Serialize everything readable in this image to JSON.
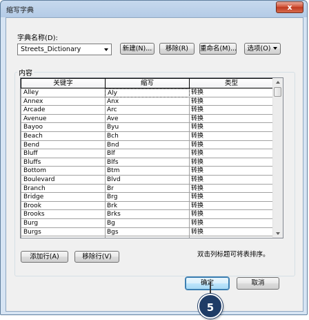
{
  "window": {
    "title": "缩写字典",
    "close_glyph": "x"
  },
  "dictionary": {
    "label": "字典名称(D):",
    "selected": "Streets_Dictionary"
  },
  "buttons": {
    "new": "新建(N)...",
    "remove": "移除(R)",
    "rename": "重命名(M)...",
    "options": "选项(O)"
  },
  "group": {
    "label": "内容"
  },
  "table": {
    "columns": [
      "关键字",
      "缩写",
      "类型"
    ],
    "rows": [
      [
        "Alley",
        "Aly",
        "转换"
      ],
      [
        "Annex",
        "Anx",
        "转换"
      ],
      [
        "Arcade",
        "Arc",
        "转换"
      ],
      [
        "Avenue",
        "Ave",
        "转换"
      ],
      [
        "Bayoo",
        "Byu",
        "转换"
      ],
      [
        "Beach",
        "Bch",
        "转换"
      ],
      [
        "Bend",
        "Bnd",
        "转换"
      ],
      [
        "Bluff",
        "Blf",
        "转换"
      ],
      [
        "Bluffs",
        "Blfs",
        "转换"
      ],
      [
        "Bottom",
        "Btm",
        "转换"
      ],
      [
        "Boulevard",
        "Blvd",
        "转换"
      ],
      [
        "Branch",
        "Br",
        "转换"
      ],
      [
        "Bridge",
        "Brg",
        "转换"
      ],
      [
        "Brook",
        "Brk",
        "转换"
      ],
      [
        "Brooks",
        "Brks",
        "转换"
      ],
      [
        "Burg",
        "Bg",
        "转换"
      ],
      [
        "Burgs",
        "Bgs",
        "转换"
      ],
      [
        "",
        "",
        ""
      ]
    ]
  },
  "actions": {
    "add_row": "添加行(A)",
    "remove_row": "移除行(V)",
    "hint": "双击列标题可将表排序。"
  },
  "footer": {
    "ok": "确定",
    "cancel": "取消"
  },
  "callout": {
    "number": "5"
  },
  "colors": {
    "callout": "#1f3c66",
    "close": "#c8432a",
    "ok_focus": "#3c7fb1"
  }
}
